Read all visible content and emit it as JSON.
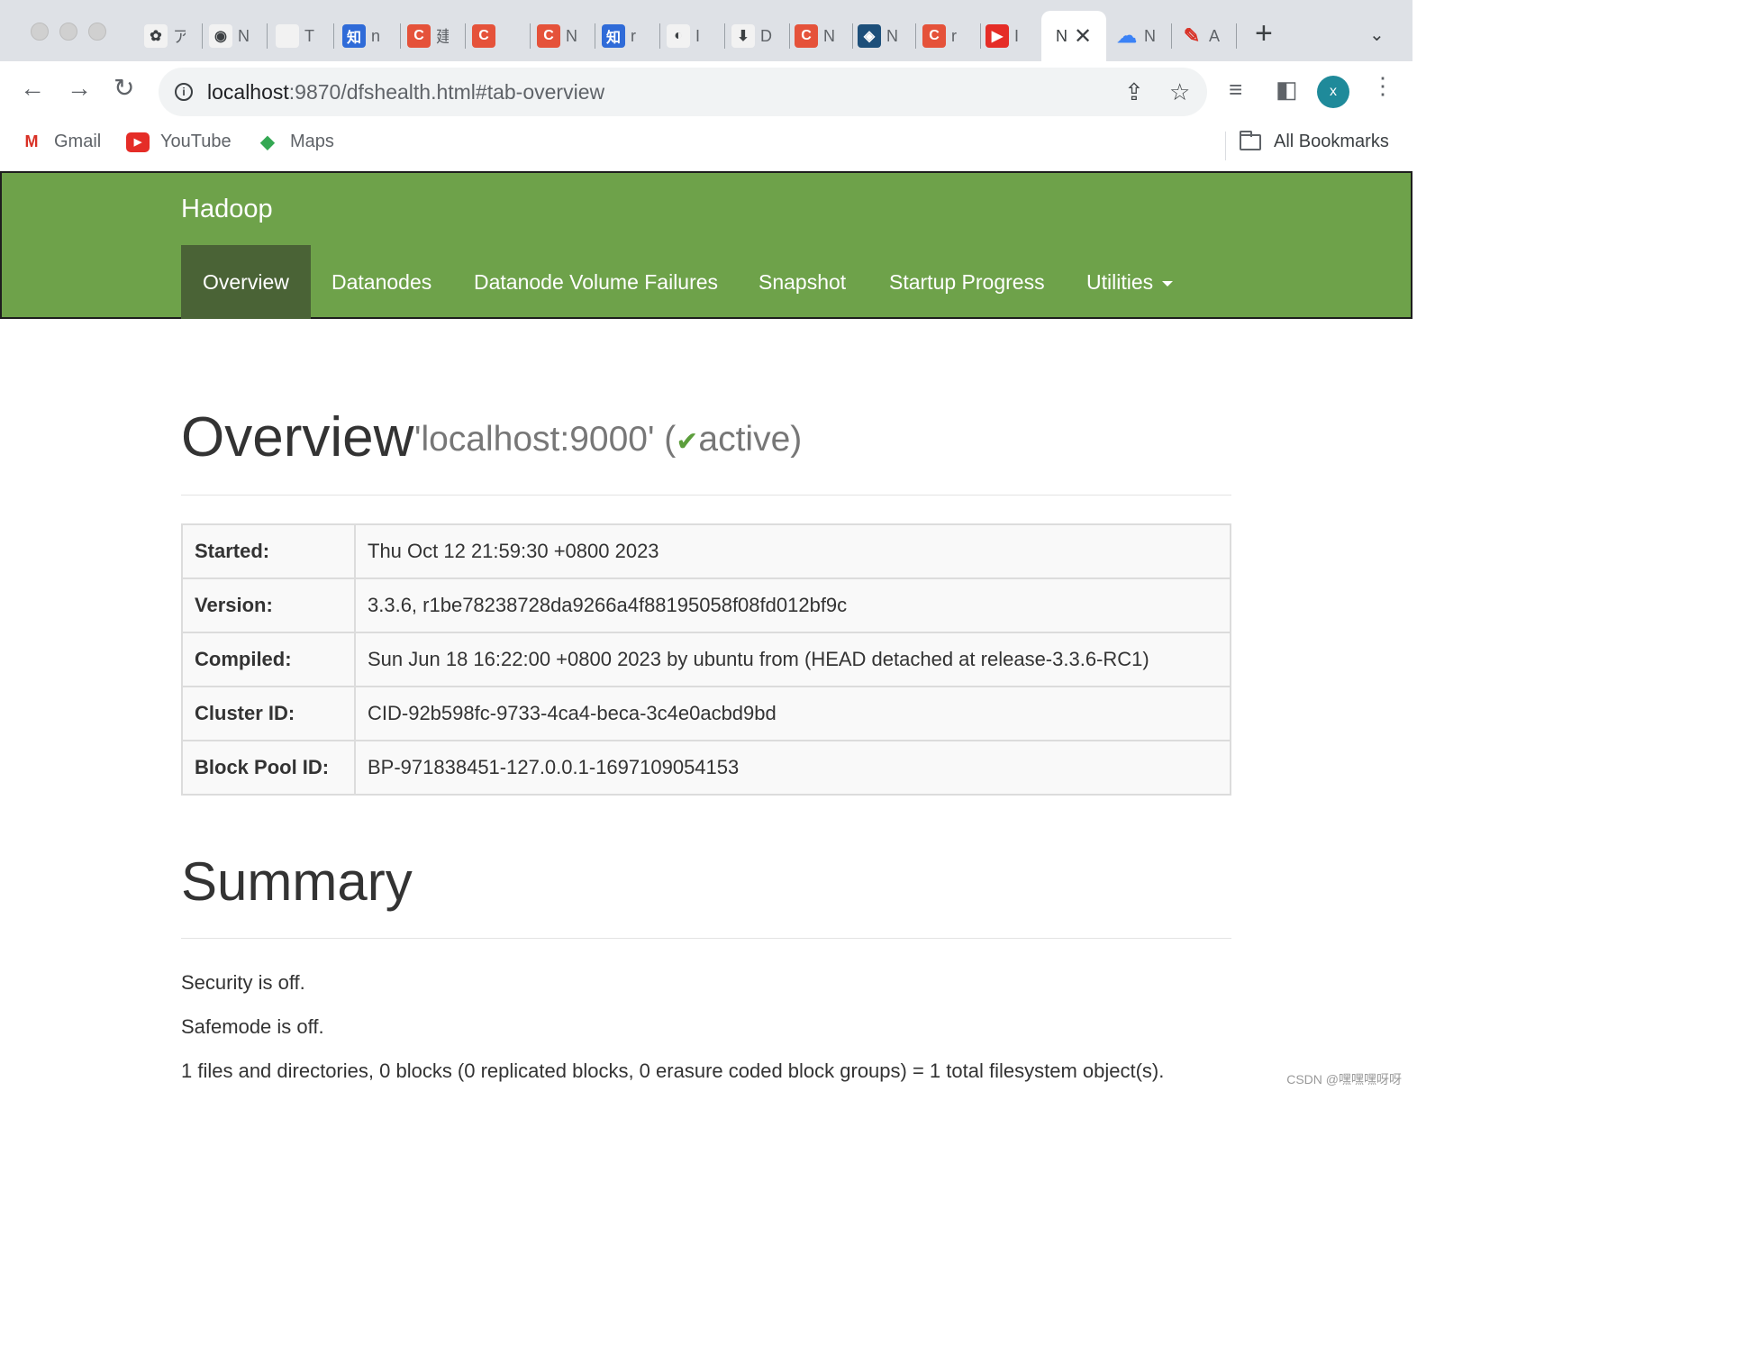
{
  "browser": {
    "tabs": [
      {
        "letter": "ア",
        "color": "#f2f2f2",
        "glyph": "✿",
        "icon": "colorful-logo-icon"
      },
      {
        "letter": "N",
        "color": "#f2f2f2",
        "glyph": "◉",
        "icon": "github-icon"
      },
      {
        "letter": "T",
        "color": "#f2f2f2",
        "glyph": "",
        "icon": "apple-icon"
      },
      {
        "letter": "n",
        "color": "#2f6bd8",
        "glyph": "知",
        "icon": "zhihu-icon"
      },
      {
        "letter": "建",
        "color": "#e5523a",
        "glyph": "C",
        "icon": "csdn-icon"
      },
      {
        "letter": "",
        "color": "#e5523a",
        "glyph": "C",
        "icon": "csdn-icon"
      },
      {
        "letter": "N",
        "color": "#e5523a",
        "glyph": "C",
        "icon": "csdn-icon"
      },
      {
        "letter": "r",
        "color": "#2f6bd8",
        "glyph": "知",
        "icon": "zhihu-icon"
      },
      {
        "letter": "I",
        "color": "#f2f2f2",
        "glyph": "◐",
        "icon": "globe-icon"
      },
      {
        "letter": "D",
        "color": "#f2f2f2",
        "glyph": "⬇",
        "icon": "download-icon"
      },
      {
        "letter": "N",
        "color": "#e5523a",
        "glyph": "C",
        "icon": "csdn-icon"
      },
      {
        "letter": "N",
        "color": "#1d4f7a",
        "glyph": "◈",
        "icon": "mysql-icon"
      },
      {
        "letter": "r",
        "color": "#e5523a",
        "glyph": "C",
        "icon": "csdn-icon"
      },
      {
        "letter": "I",
        "color": "#e52d27",
        "glyph": "▶",
        "icon": "youtube-icon"
      }
    ],
    "active_tab": {
      "letter": "N",
      "close": "✕"
    },
    "after_tabs": [
      {
        "letter": "N",
        "glyph": "☁",
        "icon": "cloud-icon"
      },
      {
        "letter": "A",
        "glyph": "✎",
        "icon": "feather-icon"
      }
    ],
    "new_tab": "+",
    "tab_search": "⌄",
    "back": "←",
    "forward": "→",
    "reload": "↻",
    "info_glyph": "i",
    "url_host": "localhost",
    "url_rest": ":9870/dfshealth.html#tab-overview",
    "share_glyph": "⇪",
    "star_glyph": "☆",
    "media_glyph": "≡",
    "sidepanel_glyph": "◧",
    "avatar_letter": "x",
    "menu_glyph": "⋮",
    "bookmarks": [
      {
        "label": "Gmail",
        "glyph": "M",
        "color": "#d93025",
        "icon": "gmail-icon"
      },
      {
        "label": "YouTube",
        "glyph": "▶",
        "color": "#e52d27",
        "icon": "youtube-icon"
      },
      {
        "label": "Maps",
        "glyph": "◆",
        "color": "#34a853",
        "icon": "maps-icon"
      }
    ],
    "all_bookmarks": "All Bookmarks"
  },
  "page": {
    "brand": "Hadoop",
    "nav": [
      "Overview",
      "Datanodes",
      "Datanode Volume Failures",
      "Snapshot",
      "Startup Progress",
      "Utilities"
    ],
    "overview": {
      "title": "Overview",
      "subtitle_prefix": "'localhost:9000' (",
      "check": "✔",
      "subtitle_status": "active)"
    },
    "info_rows": [
      {
        "key": "Started:",
        "value": "Thu Oct 12 21:59:30 +0800 2023"
      },
      {
        "key": "Version:",
        "value": "3.3.6, r1be78238728da9266a4f88195058f08fd012bf9c"
      },
      {
        "key": "Compiled:",
        "value": "Sun Jun 18 16:22:00 +0800 2023 by ubuntu from (HEAD detached at release-3.3.6-RC1)"
      },
      {
        "key": "Cluster ID:",
        "value": "CID-92b598fc-9733-4ca4-beca-3c4e0acbd9bd"
      },
      {
        "key": "Block Pool ID:",
        "value": "BP-971838451-127.0.0.1-1697109054153"
      }
    ],
    "summary": {
      "title": "Summary",
      "security": "Security is off.",
      "safemode": "Safemode is off.",
      "files": "1 files and directories, 0 blocks (0 replicated blocks, 0 erasure coded block groups) = 1 total filesystem object(s)."
    },
    "watermark": "CSDN @嘿嘿嘿呀呀"
  }
}
